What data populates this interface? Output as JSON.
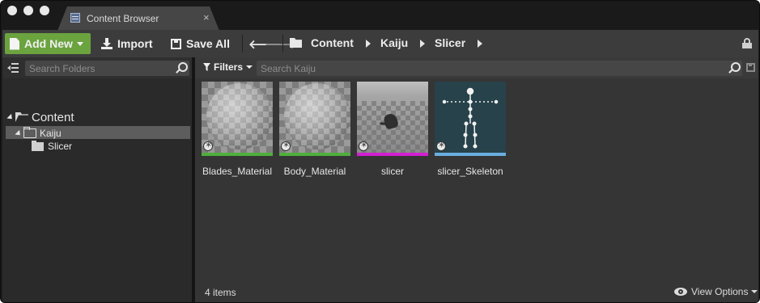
{
  "window": {
    "tab_title": "Content Browser",
    "close_glyph": "×"
  },
  "toolbar": {
    "add_new_label": "Add New",
    "import_label": "Import",
    "save_all_label": "Save All",
    "back_glyph": "🡐",
    "forward_glyph": "🡒",
    "breadcrumb": [
      "Content",
      "Kaiju",
      "Slicer"
    ]
  },
  "sources": {
    "search_placeholder": "Search Folders",
    "tree": [
      {
        "label": "Content",
        "depth": 0,
        "expanded": true
      },
      {
        "label": "Kaiju",
        "depth": 1,
        "expanded": true,
        "selected": true
      },
      {
        "label": "Slicer",
        "depth": 2
      }
    ]
  },
  "assets_panel": {
    "filters_label": "Filters",
    "search_placeholder": "Search Kaiju",
    "items": [
      {
        "name": "Blades_Material",
        "thumbnail": "material-sphere",
        "type_color": "#4faf3d"
      },
      {
        "name": "Body_Material",
        "thumbnail": "material-sphere",
        "type_color": "#4faf3d"
      },
      {
        "name": "slicer",
        "thumbnail": "skeletal-mesh-preview",
        "type_color": "#d11fd1"
      },
      {
        "name": "slicer_Skeleton",
        "thumbnail": "skeleton-preview",
        "type_color": "#6aaee0"
      }
    ],
    "status": "4 items",
    "view_options_label": "View Options"
  },
  "colors": {
    "add_new_button": "#6ba33f",
    "panel_bg": "#353535",
    "selection": "#5d5d5d"
  }
}
